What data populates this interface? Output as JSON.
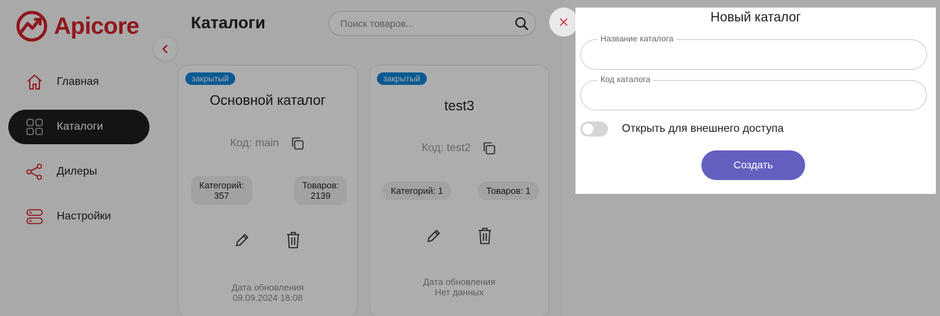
{
  "brand": {
    "name": "Apicore",
    "color": "#d4202b"
  },
  "sidebar": {
    "items": [
      {
        "label": "Главная",
        "icon": "home-icon",
        "active": false
      },
      {
        "label": "Каталоги",
        "icon": "grid-icon",
        "active": true
      },
      {
        "label": "Дилеры",
        "icon": "share-icon",
        "active": false
      },
      {
        "label": "Настройки",
        "icon": "server-icon",
        "active": false
      }
    ]
  },
  "header": {
    "title": "Каталоги",
    "search_placeholder": "Поиск товаров..."
  },
  "catalogs": [
    {
      "status": "закрытый",
      "title": "Основной каталог",
      "code": "Код: main",
      "categories": "Категорий:\n357",
      "products": "Товаров:\n2139",
      "updated_label": "Дата обновления",
      "updated_value": "09.09.2024 18:08"
    },
    {
      "status": "закрытый",
      "title": "test3",
      "code": "Код: test2",
      "categories": "Категорий: 1",
      "products": "Товаров: 1",
      "updated_label": "Дата обновления",
      "updated_value": "Нет данных"
    }
  ],
  "modal": {
    "title": "Новый каталог",
    "name_field": {
      "label": "Название каталога",
      "value": ""
    },
    "code_field": {
      "label": "Код каталога",
      "value": ""
    },
    "toggle": {
      "label": "Открыть для внешнего доступа",
      "on": false
    },
    "submit_label": "Создать",
    "submit_color": "#6460c0"
  }
}
